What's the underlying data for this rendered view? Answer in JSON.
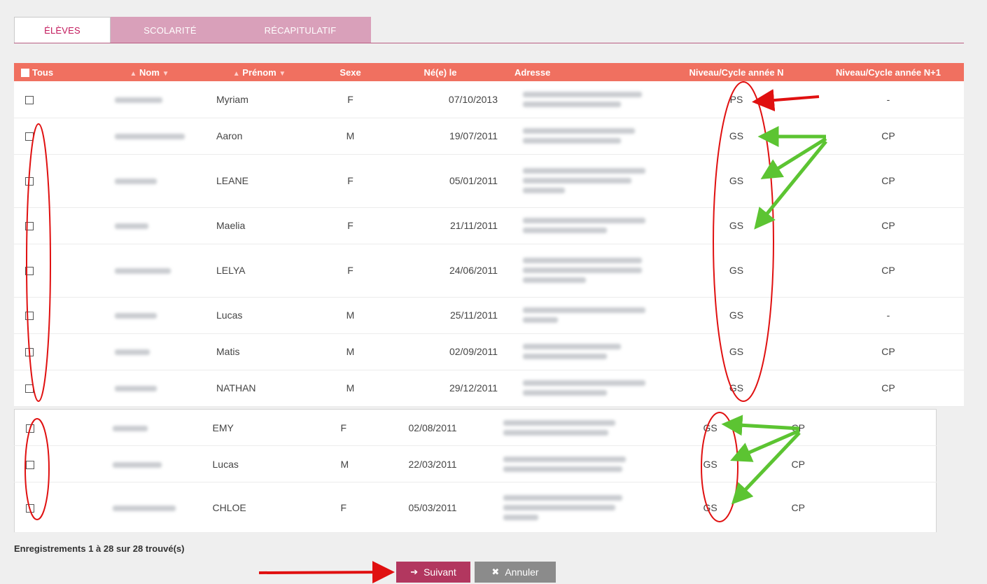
{
  "tabs": [
    {
      "label": "ÉLÈVES"
    },
    {
      "label": "SCOLARITÉ"
    },
    {
      "label": "RÉCAPITULATIF"
    }
  ],
  "table": {
    "headers": {
      "all": "Tous",
      "nom": "Nom",
      "prenom": "Prénom",
      "sexe": "Sexe",
      "ne_le": "Né(e) le",
      "adresse": "Adresse",
      "niveau_n": "Niveau/Cycle année N",
      "niveau_n1": "Niveau/Cycle année N+1"
    },
    "rows": [
      {
        "prenom": "Myriam",
        "sexe": "F",
        "ne_le": "07/10/2013",
        "niveau_n": "PS",
        "niveau_n1": "-"
      },
      {
        "prenom": "Aaron",
        "sexe": "M",
        "ne_le": "19/07/2011",
        "niveau_n": "GS",
        "niveau_n1": "CP"
      },
      {
        "prenom": "LEANE",
        "sexe": "F",
        "ne_le": "05/01/2011",
        "niveau_n": "GS",
        "niveau_n1": "CP"
      },
      {
        "prenom": "Maelia",
        "sexe": "F",
        "ne_le": "21/11/2011",
        "niveau_n": "GS",
        "niveau_n1": "CP"
      },
      {
        "prenom": "LELYA",
        "sexe": "F",
        "ne_le": "24/06/2011",
        "niveau_n": "GS",
        "niveau_n1": "CP"
      },
      {
        "prenom": "Lucas",
        "sexe": "M",
        "ne_le": "25/11/2011",
        "niveau_n": "GS",
        "niveau_n1": "-"
      },
      {
        "prenom": "Matis",
        "sexe": "M",
        "ne_le": "02/09/2011",
        "niveau_n": "GS",
        "niveau_n1": "CP"
      },
      {
        "prenom": "NATHAN",
        "sexe": "M",
        "ne_le": "29/12/2011",
        "niveau_n": "GS",
        "niveau_n1": "CP"
      }
    ],
    "rows2": [
      {
        "prenom": "EMY",
        "sexe": "F",
        "ne_le": "02/08/2011",
        "niveau_n": "GS",
        "niveau_n1": "CP"
      },
      {
        "prenom": "Lucas",
        "sexe": "M",
        "ne_le": "22/03/2011",
        "niveau_n": "GS",
        "niveau_n1": "CP"
      },
      {
        "prenom": "CHLOE",
        "sexe": "F",
        "ne_le": "05/03/2011",
        "niveau_n": "GS",
        "niveau_n1": "CP"
      }
    ]
  },
  "footer": {
    "count": "Enregistrements 1 à 28 sur 28 trouvé(s)",
    "next_label": "Suivant",
    "cancel_label": "Annuler"
  },
  "icons": {
    "next": "arrow-right-icon",
    "cancel": "x-icon"
  },
  "colors": {
    "header": "#f07060",
    "tab_active_text": "#c2185b",
    "tab_inactive": "#d9a0ba",
    "next_button": "#b2375f",
    "cancel_button": "#8b8b8b",
    "annotation_red": "#e01010",
    "annotation_green": "#5cc432"
  }
}
